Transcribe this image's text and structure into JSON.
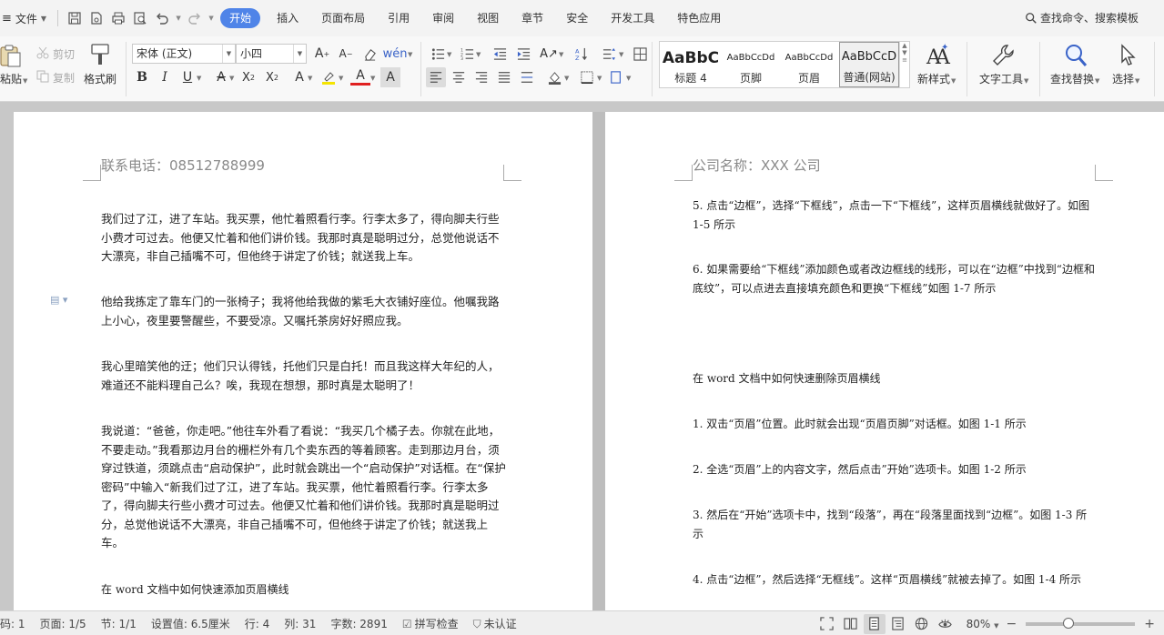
{
  "menubar": {
    "file_label": "文件",
    "tabs": [
      {
        "label": "开始",
        "active": true
      },
      {
        "label": "插入"
      },
      {
        "label": "页面布局"
      },
      {
        "label": "引用"
      },
      {
        "label": "审阅"
      },
      {
        "label": "视图"
      },
      {
        "label": "章节"
      },
      {
        "label": "安全"
      },
      {
        "label": "开发工具"
      },
      {
        "label": "特色应用"
      }
    ],
    "search_label": "查找命令、搜索模板",
    "accent_color": "#4f84e8"
  },
  "ribbon": {
    "paste_label": "粘贴",
    "cut_label": "剪切",
    "copy_label": "复制",
    "format_painter_label": "格式刷",
    "font_name": "宋体 (正文)",
    "font_size": "小四",
    "styles": [
      {
        "preview": "AaBbC",
        "name": "标题 4"
      },
      {
        "preview": "AaBbCcDd",
        "name": "页脚"
      },
      {
        "preview": "AaBbCcDd",
        "name": "页眉"
      },
      {
        "preview": "AaBbCcD",
        "name": "普通(网站)",
        "selected": true
      }
    ],
    "new_style_label": "新样式",
    "text_tool_label": "文字工具",
    "find_replace_label": "查找替换",
    "select_label": "选择"
  },
  "document": {
    "page1": {
      "header": "联系电话：08512788999",
      "paragraphs": [
        "我们过了江，进了车站。我买票，他忙着照看行李。行李太多了，得向脚夫行些小费才可过去。他便又忙着和他们讲价钱。我那时真是聪明过分，总觉他说话不大漂亮，非自己插嘴不可，但他终于讲定了价钱；就送我上车。",
        "他给我拣定了靠车门的一张椅子；我将他给我做的紫毛大衣铺好座位。他嘱我路上小心，夜里要警醒些，不要受凉。又嘱托茶房好好照应我。",
        "我心里暗笑他的迂；他们只认得钱，托他们只是白托！而且我这样大年纪的人，难道还不能料理自己么？唉，我现在想想，那时真是太聪明了！",
        "我说道：“爸爸，你走吧。”他往车外看了看说：“我买几个橘子去。你就在此地，不要走动。”我看那边月台的栅栏外有几个卖东西的等着顾客。走到那边月台，须穿过铁道，须跳点击“启动保护”，此时就会跳出一个“启动保护”对话框。在“保护密码”中输入“新我们过了江，进了车站。我买票，他忙着照看行李。行李太多了，得向脚夫行些小费才可过去。他便又忙着和他们讲价钱。我那时真是聪明过分，总觉他说话不大漂亮，非自己插嘴不可，但他终于讲定了价钱；就送我上车。",
        "在 word 文档中如何快速添加页眉横线"
      ]
    },
    "page2": {
      "header": "公司名称：XXX 公司",
      "paragraphs": [
        "5. 点击“边框”，选择“下框线”，点击一下“下框线”，这样页眉横线就做好了。如图 1-5 所示",
        "6. 如果需要给“下框线”添加颜色或者改边框线的线形，可以在“边框”中找到“边框和底纹”，可以点进去直接填充颜色和更换“下框线”如图 1-7 所示",
        "在 word 文档中如何快速删除页眉横线",
        "1. 双击“页眉”位置。此时就会出现“页眉页脚”对话框。如图 1-1 所示",
        "2. 全选“页眉”上的内容文字，然后点击”开始”选项卡。如图 1-2 所示",
        "3. 然后在“开始”选项卡中，找到“段落”，再在“段落里面找到“边框”。如图 1-3 所示",
        "4. 点击“边框”，然后选择“无框线”。这样“页眉横线”就被去掉了。如图 1-4 所示"
      ]
    }
  },
  "statusbar": {
    "page_num": "码: 1",
    "pages": "页面: 1/5",
    "section": "节: 1/1",
    "setting": "设置值: 6.5厘米",
    "row": "行: 4",
    "col": "列: 31",
    "words": "字数: 2891",
    "spellcheck": "拼写检查",
    "auth": "未认证",
    "zoom": "80%",
    "zoom_minus": "−",
    "zoom_plus": "+",
    "zoom_percent": 80
  }
}
